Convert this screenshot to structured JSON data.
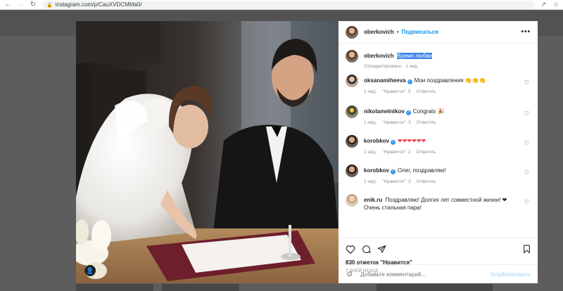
{
  "browser": {
    "url": "instagram.com/p/CauXVDCMMa0/",
    "back_icon": "arrow-left-icon",
    "forward_icon": "arrow-right-icon",
    "reload_icon": "reload-icon"
  },
  "post": {
    "author": "oberkovich",
    "follow_label": "Подписаться",
    "dot": "•",
    "caption": {
      "user": "oberkovich",
      "text": "Время любви",
      "meta": "Отредактировано · 1 нед."
    },
    "comments": [
      {
        "user": "oksanamiheeva",
        "verified": true,
        "text": "Мои поздравления 👏👏👏",
        "age": "1 нед.",
        "likes": "\"Нравится\": 5",
        "reply": "Ответить"
      },
      {
        "user": "nikolamelnikov",
        "verified": true,
        "text": "Congrats 🎉",
        "age": "1 нед.",
        "likes": "\"Нравится\": 3",
        "reply": "Ответить"
      },
      {
        "user": "korobkov",
        "verified": true,
        "text": "❤❤❤❤❤❤",
        "age": "1 нед.",
        "likes": "\"Нравится\": 2",
        "reply": "Ответить"
      },
      {
        "user": "korobkov",
        "verified": true,
        "text": "Олег, поздравляю!",
        "age": "1 нед.",
        "likes": "\"Нравится\": 3",
        "reply": "Ответить"
      },
      {
        "user": "enik.ru",
        "verified": false,
        "text": "Поздравляю! Долгих лет совместной жизни! ❤ Очень стильная пара!",
        "age": "",
        "likes": "",
        "reply": ""
      }
    ],
    "likes_count": "830 отметок \"Нравится\"",
    "posted": "7 ДНЕЙ НАЗАД",
    "comment_placeholder": "Добавьте комментарий...",
    "publish_label": "Опубликовать"
  },
  "colors": {
    "accent": "#0095f6",
    "highlight": "#3b82e6",
    "like": "#ed4956"
  }
}
